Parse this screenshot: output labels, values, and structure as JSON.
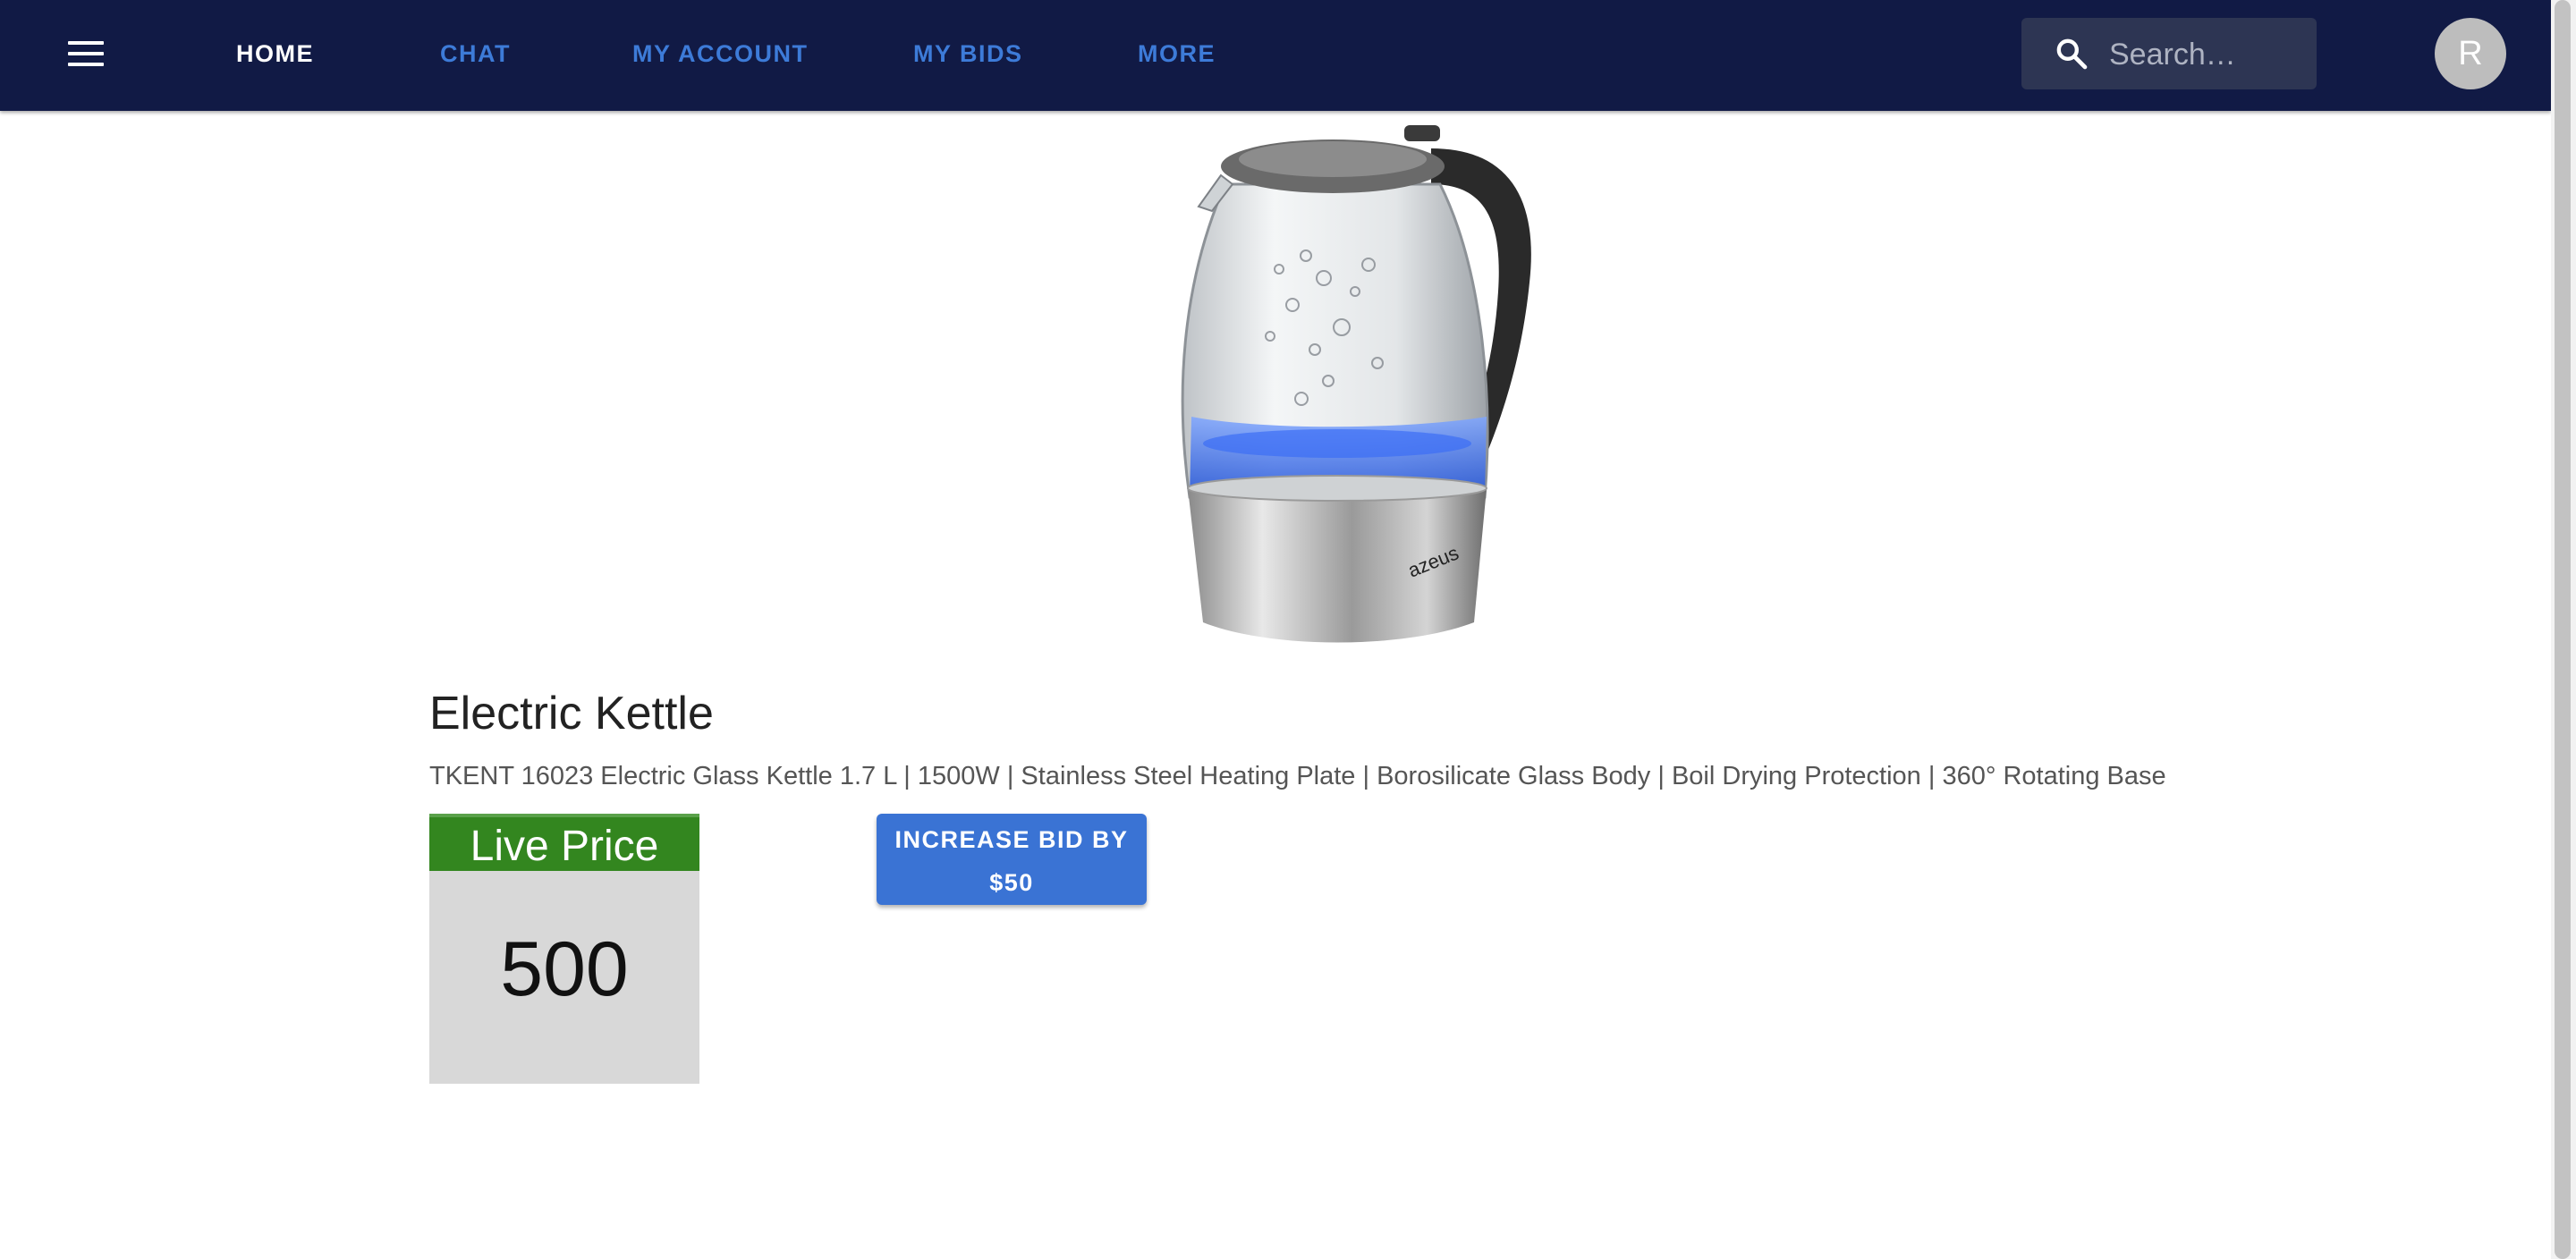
{
  "nav": {
    "menu_icon": "menu-icon",
    "links": [
      "HOME",
      "CHAT",
      "MY ACCOUNT",
      "MY BIDS",
      "MORE"
    ],
    "active": "HOME",
    "search_icon": "search-icon",
    "search_placeholder": "Search…",
    "avatar_letter": "R"
  },
  "product": {
    "title": "Electric Kettle",
    "description": "TKENT 16023 Electric Glass Kettle 1.7 L | 1500W | Stainless Steel Heating Plate | Borosilicate Glass Body | Boil Drying Protection | 360° Rotating Base",
    "brand_mark": "azeus"
  },
  "price": {
    "label": "Live Price",
    "value": "500"
  },
  "bid": {
    "line1": "INCREASE BID BY",
    "line2": "$50"
  },
  "colors": {
    "appbar": "#111a45",
    "nav_link": "#3d7bd8",
    "live_price_header": "#33861f",
    "bid_button": "#3a73d4"
  }
}
